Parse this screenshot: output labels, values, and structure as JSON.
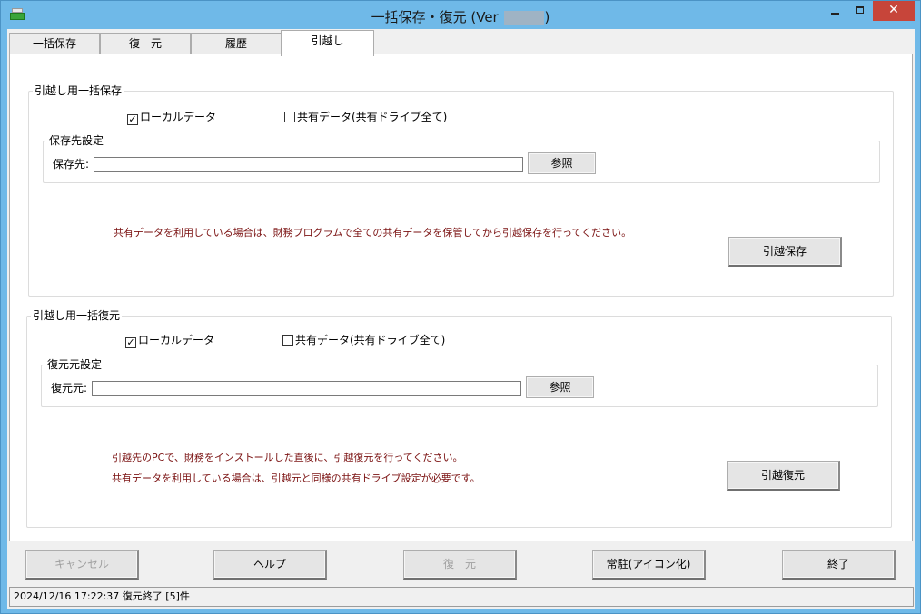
{
  "window": {
    "title_prefix": "一括保存・復元 (Ver",
    "title_suffix": ")",
    "min_icon": "minimize-icon",
    "max_icon": "maximize-icon",
    "close_label": "✕"
  },
  "tabs": [
    {
      "label": "一括保存"
    },
    {
      "label": "復　元"
    },
    {
      "label": "履歴"
    },
    {
      "label": "引越し"
    }
  ],
  "save_group": {
    "title": "引越し用一括保存",
    "local_label": "ローカルデータ",
    "local_checked": "✓",
    "shared_label": "共有データ(共有ドライブ全て)",
    "dest_group_title": "保存先設定",
    "dest_label": "保存先:",
    "dest_value": "",
    "browse_label": "参照",
    "note": "共有データを利用している場合は、財務プログラムで全ての共有データを保管してから引越保存を行ってください。",
    "action_label": "引越保存"
  },
  "restore_group": {
    "title": "引越し用一括復元",
    "local_label": "ローカルデータ",
    "local_checked": "✓",
    "shared_label": "共有データ(共有ドライブ全て)",
    "src_group_title": "復元元設定",
    "src_label": "復元元:",
    "src_value": "",
    "browse_label": "参照",
    "note1": "引越先のPCで、財務をインストールした直後に、引越復元を行ってください。",
    "note2": "共有データを利用している場合は、引越元と同様の共有ドライブ設定が必要です。",
    "action_label": "引越復元"
  },
  "footer": {
    "cancel": "キャンセル",
    "help": "ヘルプ",
    "restore": "復　元",
    "resident": "常駐(アイコン化)",
    "exit": "終了"
  },
  "status": {
    "text": "2024/12/16 17:22:37 復元終了 [5]件"
  }
}
